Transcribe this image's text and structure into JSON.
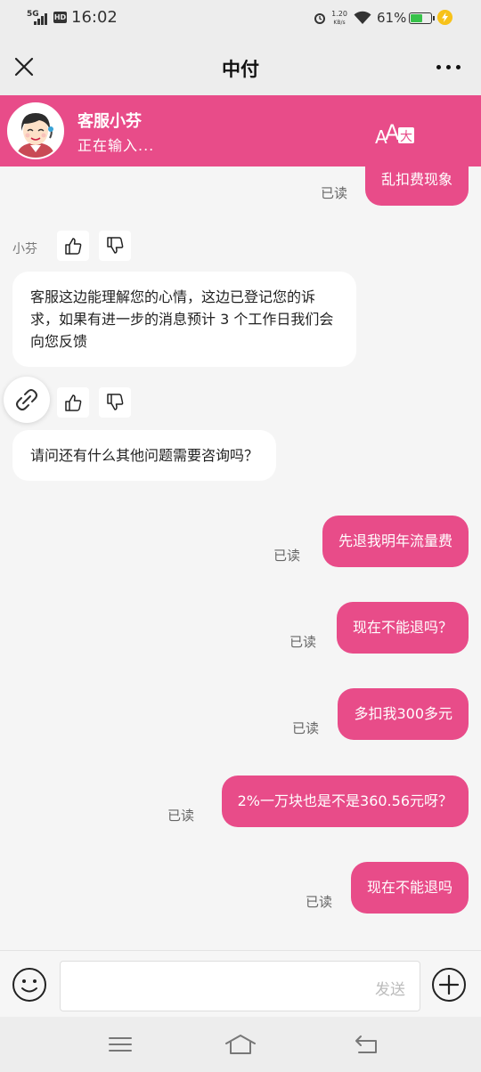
{
  "status_bar": {
    "network": "5G",
    "hd": "HD",
    "time": "16:02",
    "speed_value": "1.20",
    "speed_unit": "KB/s",
    "battery_percent": "61%",
    "battery_level": 0.61,
    "battery_color": "#37c24a"
  },
  "title_bar": {
    "title": "中付",
    "close_icon": "close-icon",
    "more_icon": "more-icon"
  },
  "agent": {
    "name": "客服小芬",
    "status": "正在输入...",
    "header_color": "#e84c89",
    "font_size_icon": "font-size-icon"
  },
  "messages": {
    "m0": {
      "text": "乱扣费现象",
      "read": "已读"
    },
    "m1": {
      "sender": "小芬",
      "text": "客服这边能理解您的心情，这边已登记您的诉求，如果有进一步的消息预计 3 个工作日我们会向您反馈"
    },
    "m2": {
      "text": "请问还有什么其他问题需要咨询吗？"
    },
    "m3": {
      "text": "先退我明年流量费",
      "read": "已读"
    },
    "m4": {
      "text": "现在不能退吗？",
      "read": "已读"
    },
    "m5": {
      "text": "多扣我300多元",
      "read": "已读"
    },
    "m6": {
      "text": "2%一万块也是不是360.56元呀？",
      "read": "已读"
    },
    "m7": {
      "text": "现在不能退吗",
      "read": "已读"
    }
  },
  "input_bar": {
    "value": "",
    "send_label": "发送"
  },
  "colors": {
    "accent": "#e84c89",
    "bubble_in": "#ffffff",
    "background": "#f5f5f5"
  }
}
